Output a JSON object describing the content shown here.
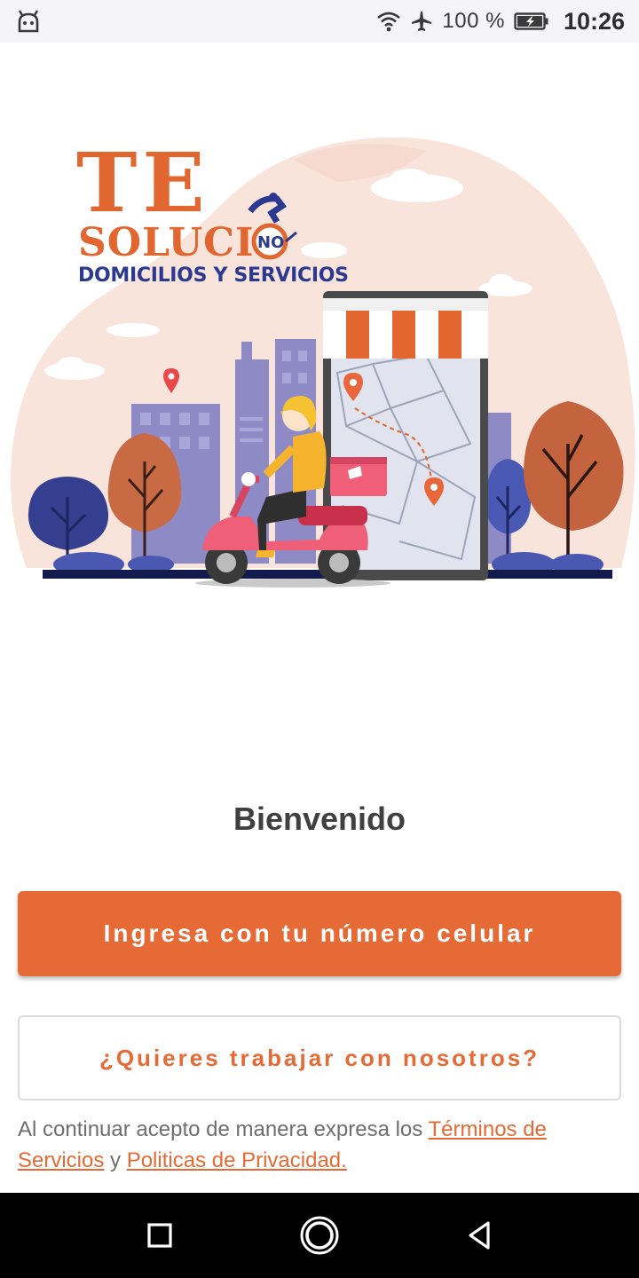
{
  "status_bar": {
    "battery_percent": "100 %",
    "time": "10:26",
    "icons": [
      "android-icon",
      "wifi-icon",
      "airplane-icon",
      "battery-charging-icon"
    ]
  },
  "logo": {
    "line1": "TE",
    "line2": "SOLUCIO",
    "line2_badge": "NO",
    "line3": "DOMICILIOS Y SERVICIOS"
  },
  "welcome": {
    "title": "Bienvenido"
  },
  "actions": {
    "login_label": "Ingresa con tu número celular",
    "work_with_us_label": "¿Quieres trabajar con nosotros?"
  },
  "legal": {
    "prefix": "Al continuar acepto de manera expresa los ",
    "terms_link": "Términos de Servicios",
    "conjunction": " y ",
    "privacy_link": "Politicas de Privacidad."
  },
  "nav_bar": {
    "icons": [
      "recent-apps-icon",
      "home-icon",
      "back-icon"
    ]
  },
  "colors": {
    "accent": "#e56a35",
    "logo_blue": "#2b3a8f",
    "hero_blob": "#f8e3dc",
    "building": "#8a87c4"
  }
}
